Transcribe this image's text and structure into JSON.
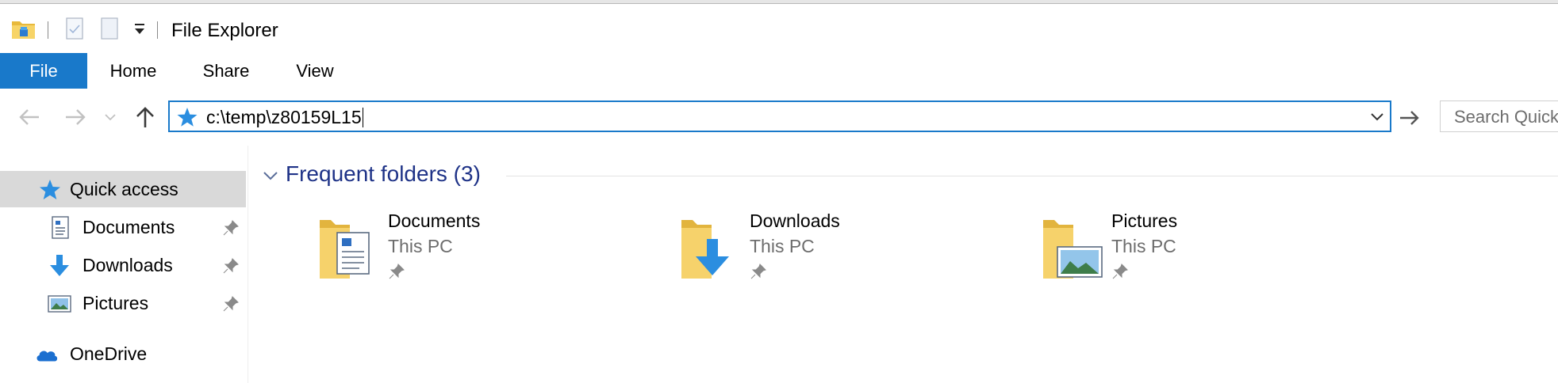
{
  "window": {
    "title": "File Explorer"
  },
  "ribbon": {
    "tabs": [
      {
        "label": "File"
      },
      {
        "label": "Home"
      },
      {
        "label": "Share"
      },
      {
        "label": "View"
      }
    ]
  },
  "address": {
    "path": "c:\\temp\\z80159L15"
  },
  "search": {
    "placeholder": "Search Quick access"
  },
  "nav": {
    "items": [
      {
        "label": "Quick access",
        "icon": "star-icon"
      },
      {
        "label": "Documents",
        "icon": "documents-icon",
        "pinned": true
      },
      {
        "label": "Downloads",
        "icon": "downloads-icon",
        "pinned": true
      },
      {
        "label": "Pictures",
        "icon": "pictures-icon",
        "pinned": true
      },
      {
        "label": "OneDrive",
        "icon": "onedrive-icon"
      }
    ]
  },
  "content": {
    "group_title": "Frequent folders (3)",
    "folders": [
      {
        "name": "Documents",
        "location": "This PC",
        "icon": "documents-folder-icon"
      },
      {
        "name": "Downloads",
        "location": "This PC",
        "icon": "downloads-folder-icon"
      },
      {
        "name": "Pictures",
        "location": "This PC",
        "icon": "pictures-folder-icon"
      }
    ]
  },
  "colors": {
    "accent": "#1979ca",
    "group_title": "#1e3287",
    "selected_bg": "#d9d9d9"
  }
}
